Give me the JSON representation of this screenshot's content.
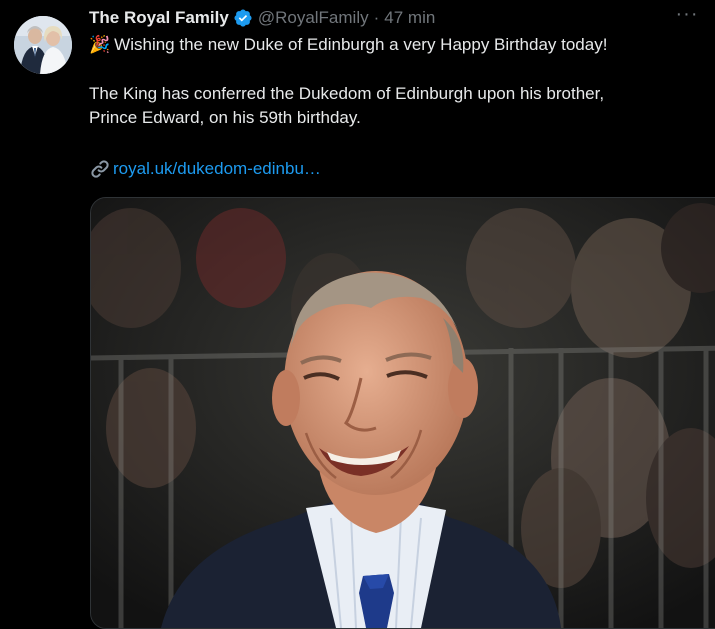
{
  "tweet": {
    "author_name": "The Royal Family",
    "handle": "@RoyalFamily",
    "separator": "·",
    "timestamp": "47 min",
    "emoji": "🎉",
    "line1": "Wishing the new Duke of Edinburgh a very Happy Birthday today!",
    "line2": "The King has conferred the Dukedom of Edinburgh upon his brother,",
    "line3": "Prince Edward, on his 59th birthday.",
    "link_text": "royal.uk/dukedom-edinbu…",
    "more_label": "···"
  },
  "icons": {
    "verified": "verified-badge-icon",
    "link": "link-icon",
    "more": "more-options-icon"
  },
  "colors": {
    "background": "#000000",
    "text": "#e7e9ea",
    "muted": "#71767b",
    "link": "#1d9bf0",
    "verified": "#1d9bf0"
  }
}
